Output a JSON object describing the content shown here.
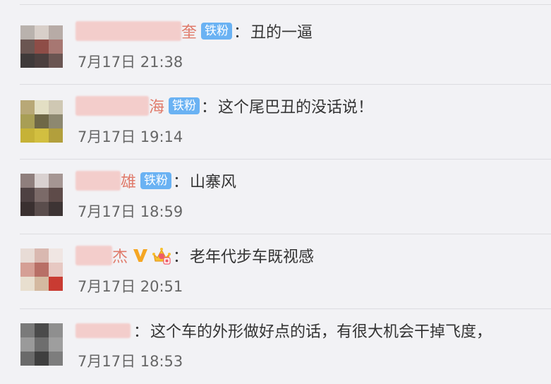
{
  "comments": [
    {
      "name_tail": "奎",
      "badge": "铁粉",
      "colon": "：",
      "text": "丑的一逼",
      "date": "7月17日 21:38"
    },
    {
      "name_tail": "海",
      "badge": "铁粉",
      "colon": "：",
      "text": "这个尾巴丑的没话说！",
      "date": "7月17日 19:14"
    },
    {
      "name_tail": "雄",
      "badge": "铁粉",
      "colon": "：",
      "text": "山寨风",
      "date": "7月17日 18:59"
    },
    {
      "name_tail": "杰",
      "badge_icon": "verified-v-icon",
      "member_icon": "crown-member-icon",
      "colon": "：",
      "text": "老年代步车既视感",
      "date": "7月17日 20:51"
    },
    {
      "name_tail": "",
      "colon": "：",
      "text": "这个车的外形做好点的话，有很大机会干掉飞度，",
      "date": "7月17日 18:53"
    }
  ],
  "colors": {
    "background": "#f2f2f5",
    "username": "#e07a6a",
    "badge": "#6ab2f3",
    "verified": "#f5a623",
    "text": "#333333",
    "date": "#666666"
  }
}
